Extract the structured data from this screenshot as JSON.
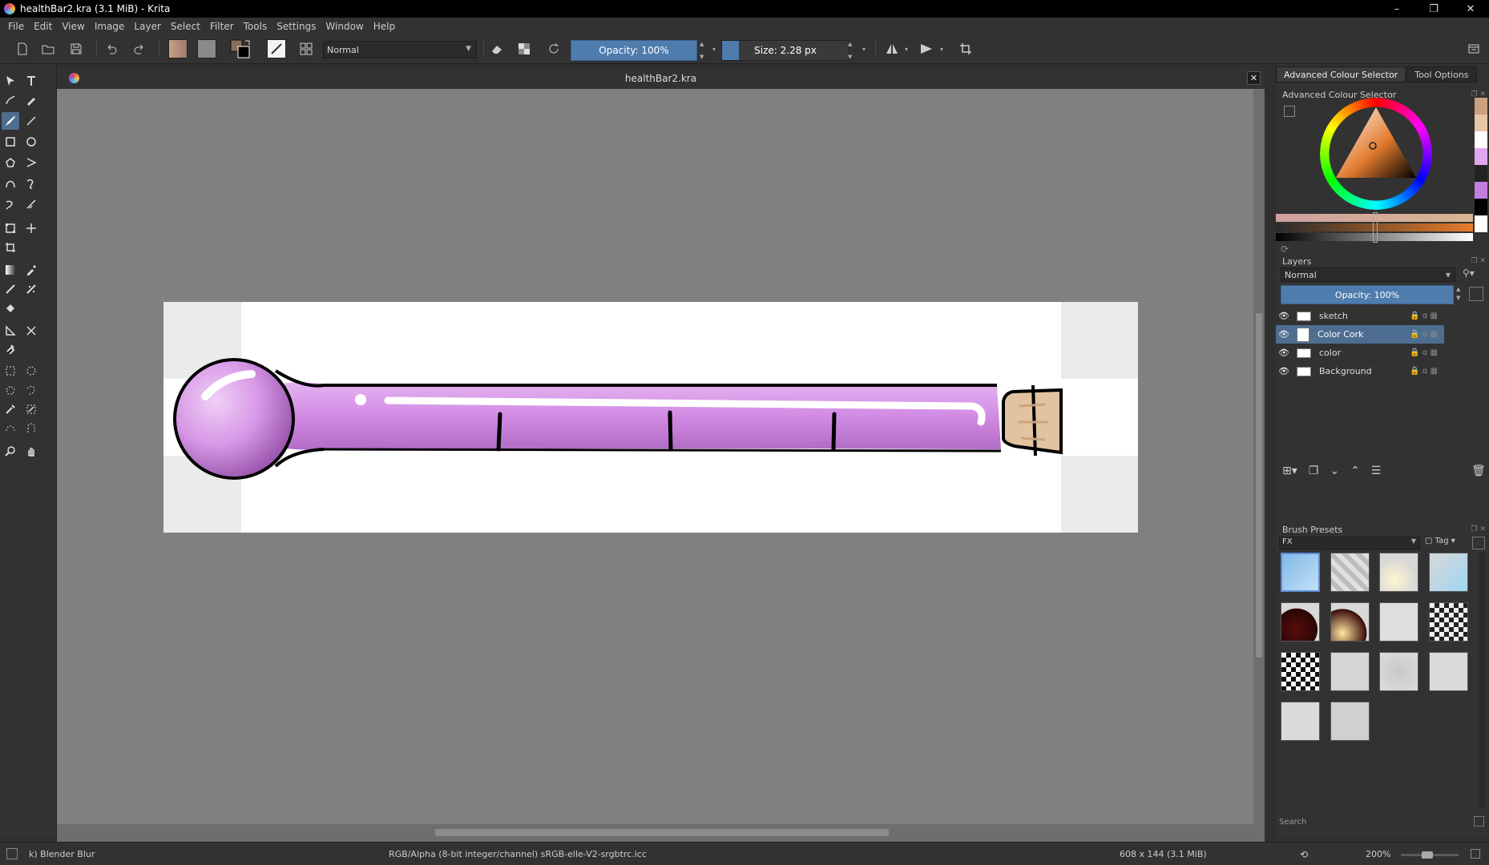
{
  "window": {
    "title": "healthBar2.kra (3.1 MiB)  - Krita",
    "controls": {
      "minimize": "–",
      "maximize": "❐",
      "close": "✕"
    }
  },
  "menu": [
    "File",
    "Edit",
    "View",
    "Image",
    "Layer",
    "Select",
    "Filter",
    "Tools",
    "Settings",
    "Window",
    "Help"
  ],
  "toolbar": {
    "blend_mode": "Normal",
    "opacity_label": "Opacity: 100%",
    "size_label": "Size: 2.28 px"
  },
  "document": {
    "tab_title": "healthBar2.kra",
    "close_glyph": "✕"
  },
  "docker_tabs": [
    "Advanced Colour Selector",
    "Tool Options"
  ],
  "colour_selector": {
    "title": "Advanced Colour Selector"
  },
  "layers": {
    "title": "Layers",
    "blend_mode": "Normal",
    "opacity_label": "Opacity:  100%",
    "items": [
      {
        "name": "sketch",
        "selected": false
      },
      {
        "name": "Color Cork",
        "selected": true
      },
      {
        "name": "color",
        "selected": false
      },
      {
        "name": "Background",
        "selected": false
      }
    ]
  },
  "brush_presets": {
    "title": "Brush Presets",
    "tag_filter": "FX",
    "tag_label": "Tag",
    "search_placeholder": "Search"
  },
  "status": {
    "brush": "k) Blender Blur",
    "color_space": "RGB/Alpha (8-bit integer/channel)  sRGB-elle-V2-srgbtrc.icc",
    "image_size": "608 x 144 (3.1 MiB)",
    "zoom": "200%"
  },
  "colors": {
    "accent": "#4e7cad",
    "selection": "#4e6e91",
    "tube_fill": "#d99ae8",
    "cork": "#e2c3a0"
  }
}
